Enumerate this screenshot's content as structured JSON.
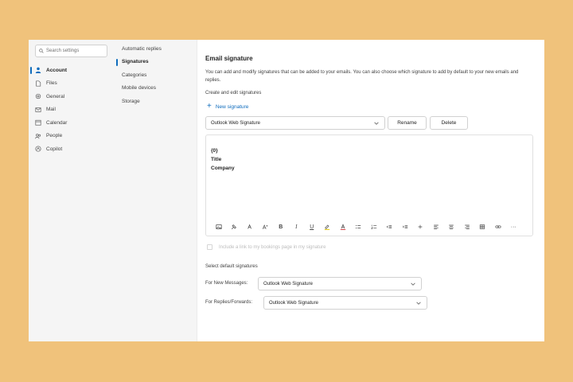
{
  "search": {
    "placeholder": "Search settings"
  },
  "nav": {
    "items": [
      {
        "label": "Account",
        "icon": "person-icon",
        "active": true
      },
      {
        "label": "Files",
        "icon": "file-icon",
        "active": false
      },
      {
        "label": "General",
        "icon": "gear-icon",
        "active": false
      },
      {
        "label": "Mail",
        "icon": "mail-icon",
        "active": false
      },
      {
        "label": "Calendar",
        "icon": "calendar-icon",
        "active": false
      },
      {
        "label": "People",
        "icon": "people-icon",
        "active": false
      },
      {
        "label": "Copilot",
        "icon": "copilot-icon",
        "active": false
      }
    ]
  },
  "subnav": {
    "items": [
      {
        "label": "Automatic replies",
        "active": false
      },
      {
        "label": "Signatures",
        "active": true
      },
      {
        "label": "Categories",
        "active": false
      },
      {
        "label": "Mobile devices",
        "active": false
      },
      {
        "label": "Storage",
        "active": false
      }
    ]
  },
  "main": {
    "title": "Email signature",
    "description": "You can add and modify signatures that can be added to your emails. You can also choose which signature to add by default to your new emails and replies.",
    "create_label": "Create and edit signatures",
    "new_signature": "New signature",
    "selected_signature": "Outlook Web Signature",
    "rename": "Rename",
    "delete": "Delete",
    "editor_lines": [
      "{0}",
      "Title",
      "Company"
    ],
    "bookings_label": "Include a link to my bookings page in my signature",
    "defaults_label": "Select default signatures",
    "new_messages_label": "For New Messages:",
    "new_messages_value": "Outlook Web Signature",
    "replies_label": "For Replies/Forwards:",
    "replies_value": "Outlook Web Signature"
  },
  "colors": {
    "accent": "#0f6cbd",
    "background": "#f0c27b",
    "sidebar": "#f5f5f5"
  }
}
